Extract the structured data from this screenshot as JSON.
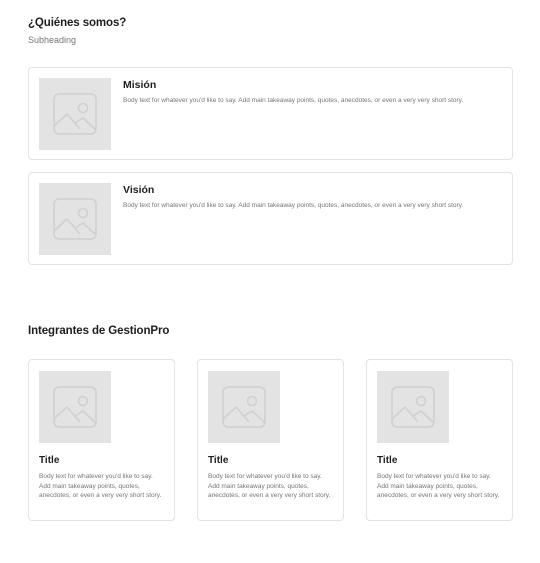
{
  "about": {
    "title": "¿Quiénes somos?",
    "subheading": "Subheading",
    "cards": [
      {
        "heading": "Misión",
        "body": "Body text for whatever you'd like to say. Add main takeaway points, quotes, anecdotes, or even a very very short story.",
        "image_icon": "image-placeholder-icon"
      },
      {
        "heading": "Visión",
        "body": "Body text for whatever you'd like to say. Add main takeaway points, quotes, anecdotes, or even a very very short story.",
        "image_icon": "image-placeholder-icon"
      }
    ]
  },
  "team": {
    "title": "Integrantes de GestionPro",
    "members": [
      {
        "title": "Title",
        "body": "Body text for whatever you'd like to say. Add main takeaway points, quotes, anecdotes, or even a very very short story.",
        "image_icon": "image-placeholder-icon"
      },
      {
        "title": "Title",
        "body": "Body text for whatever you'd like to say. Add main takeaway points, quotes, anecdotes, or even a very very short story.",
        "image_icon": "image-placeholder-icon"
      },
      {
        "title": "Title",
        "body": "Body text for whatever you'd like to say. Add main takeaway points, quotes, anecdotes, or even a very very short story.",
        "image_icon": "image-placeholder-icon"
      }
    ]
  },
  "colors": {
    "placeholder_bg": "#e3e3e3",
    "placeholder_line": "#d0d0d0",
    "border": "#e3e3e3",
    "heading": "#1e1e1e",
    "muted": "#757575"
  }
}
